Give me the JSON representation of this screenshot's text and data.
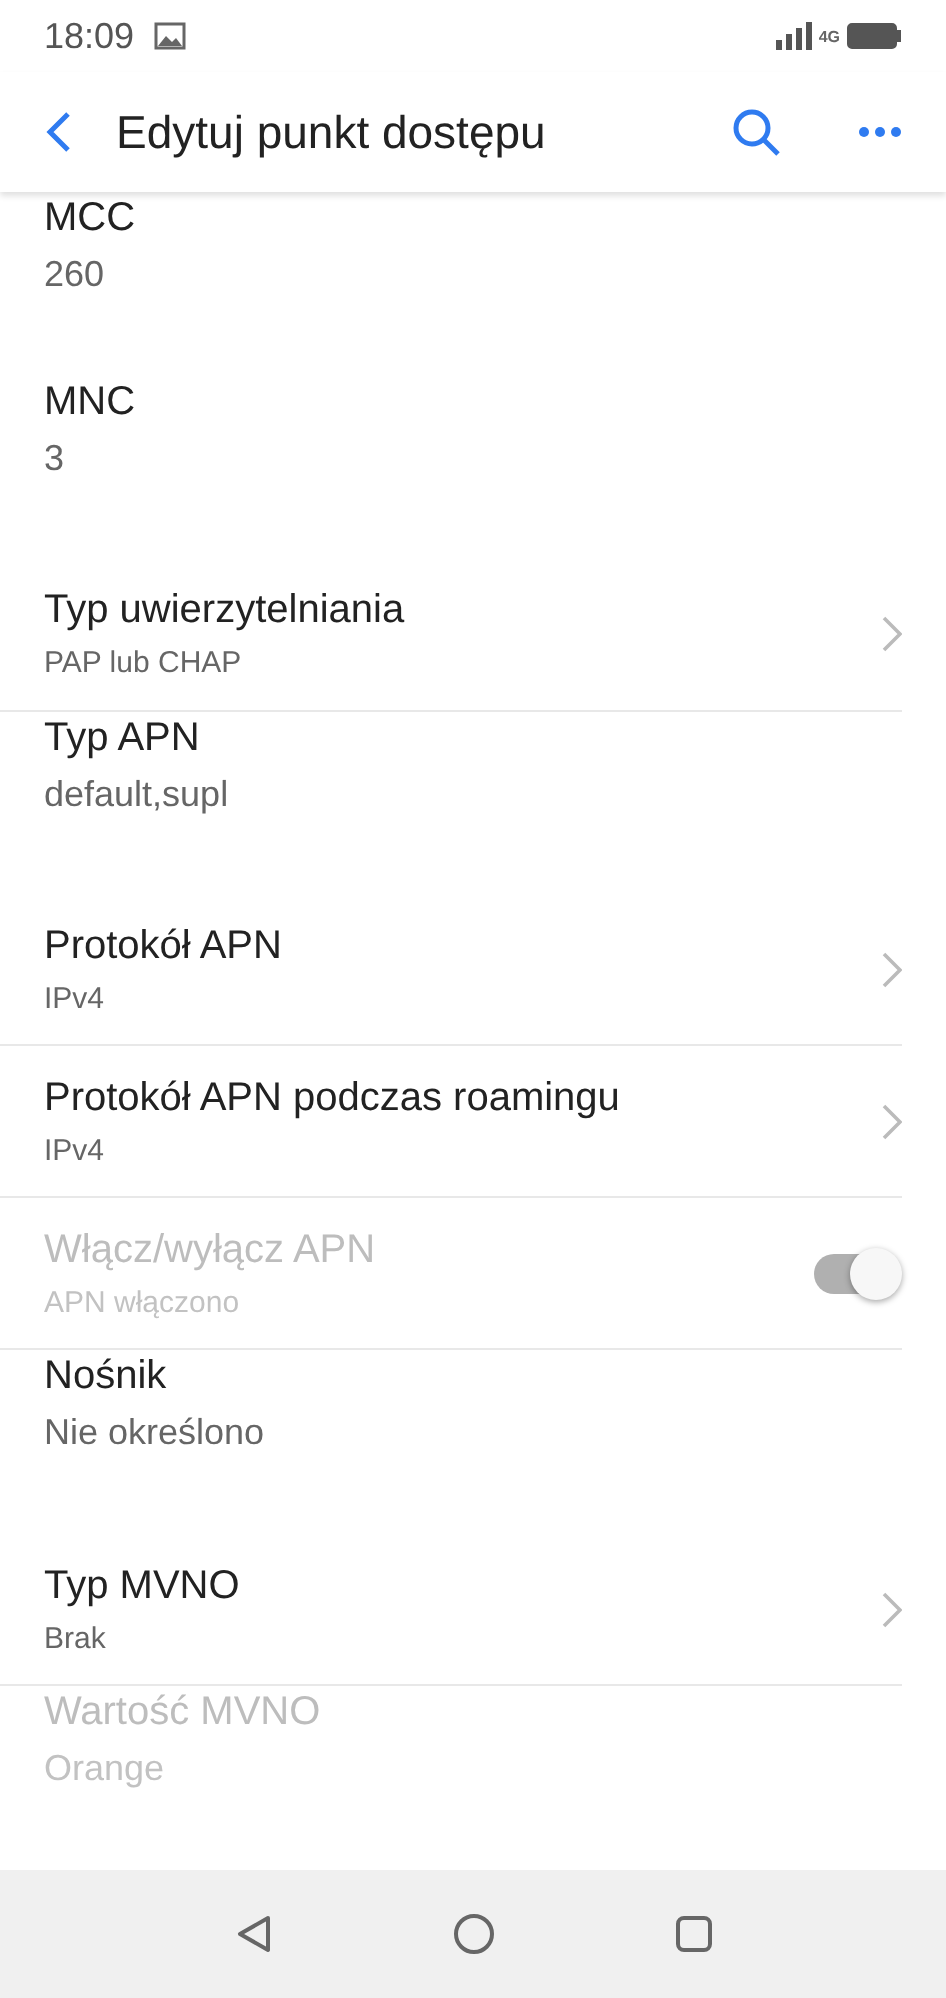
{
  "status_bar": {
    "time": "18:09",
    "network": "4G"
  },
  "app_bar": {
    "title": "Edytuj punkt dostępu"
  },
  "settings": [
    {
      "kind": "edit",
      "title": "MCC",
      "value": "260",
      "disabled": false
    },
    {
      "kind": "edit",
      "title": "MNC",
      "value": "3",
      "disabled": false
    },
    {
      "kind": "list",
      "title": "Typ uwierzytelniania",
      "value": "PAP lub CHAP",
      "disabled": false
    },
    {
      "kind": "edit",
      "title": "Typ APN",
      "value": "default,supl",
      "disabled": false
    },
    {
      "kind": "list",
      "title": "Protokół APN",
      "value": "IPv4",
      "disabled": false
    },
    {
      "kind": "list",
      "title": "Protokół APN podczas roamingu",
      "value": "IPv4",
      "disabled": false
    },
    {
      "kind": "switch",
      "title": "Włącz/wyłącz APN",
      "value": "APN włączono",
      "disabled": true,
      "on": true
    },
    {
      "kind": "edit",
      "title": "Nośnik",
      "value": "Nie określono",
      "disabled": false
    },
    {
      "kind": "list",
      "title": "Typ MVNO",
      "value": "Brak",
      "disabled": false
    },
    {
      "kind": "edit",
      "title": "Wartość MVNO",
      "value": "Orange",
      "disabled": true
    }
  ]
}
